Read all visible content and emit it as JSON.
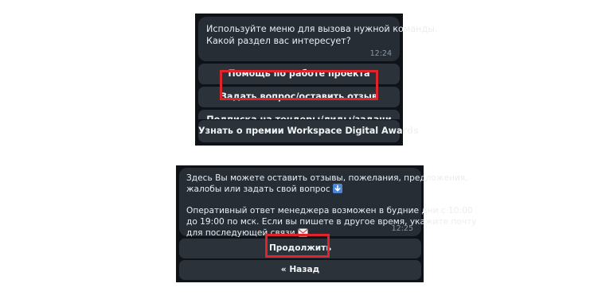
{
  "menu_screen": {
    "message_lines": [
      "Используйте меню для вызова нужной команды.",
      "Какой раздел вас интересует?"
    ],
    "time": "12:24",
    "buttons": [
      "Помощь по работе проекта",
      "Задать вопрос/оставить отзыв",
      "Подписка на тендеры/лиды/задачи",
      "Узнать о премии Workspace Digital Awards"
    ],
    "highlighted_button": "Задать вопрос/оставить отзыв"
  },
  "feedback_screen": {
    "message_lines": [
      "Здесь Вы можете оставить отзывы, пожелания, предложения,",
      "жалобы или задать свой вопрос",
      "Оперативный ответ менеджера возможен в будние дни с 10:00",
      "до 19:00 по мск. Если вы пишете в другое время, укажите почту",
      "для последующей связи"
    ],
    "time": "12:25",
    "buttons": [
      "Продолжить",
      "« Назад"
    ],
    "highlighted_button": "Продолжить",
    "icons": {
      "down_arrow": "down-arrow-emoji",
      "envelope": "envelope-emoji"
    }
  },
  "colors": {
    "background": "#0f1216",
    "bubble": "#262d35",
    "button": "#2b323a",
    "text": "#e9eef2",
    "time": "#8d98a3",
    "highlight": "#e0242c"
  }
}
